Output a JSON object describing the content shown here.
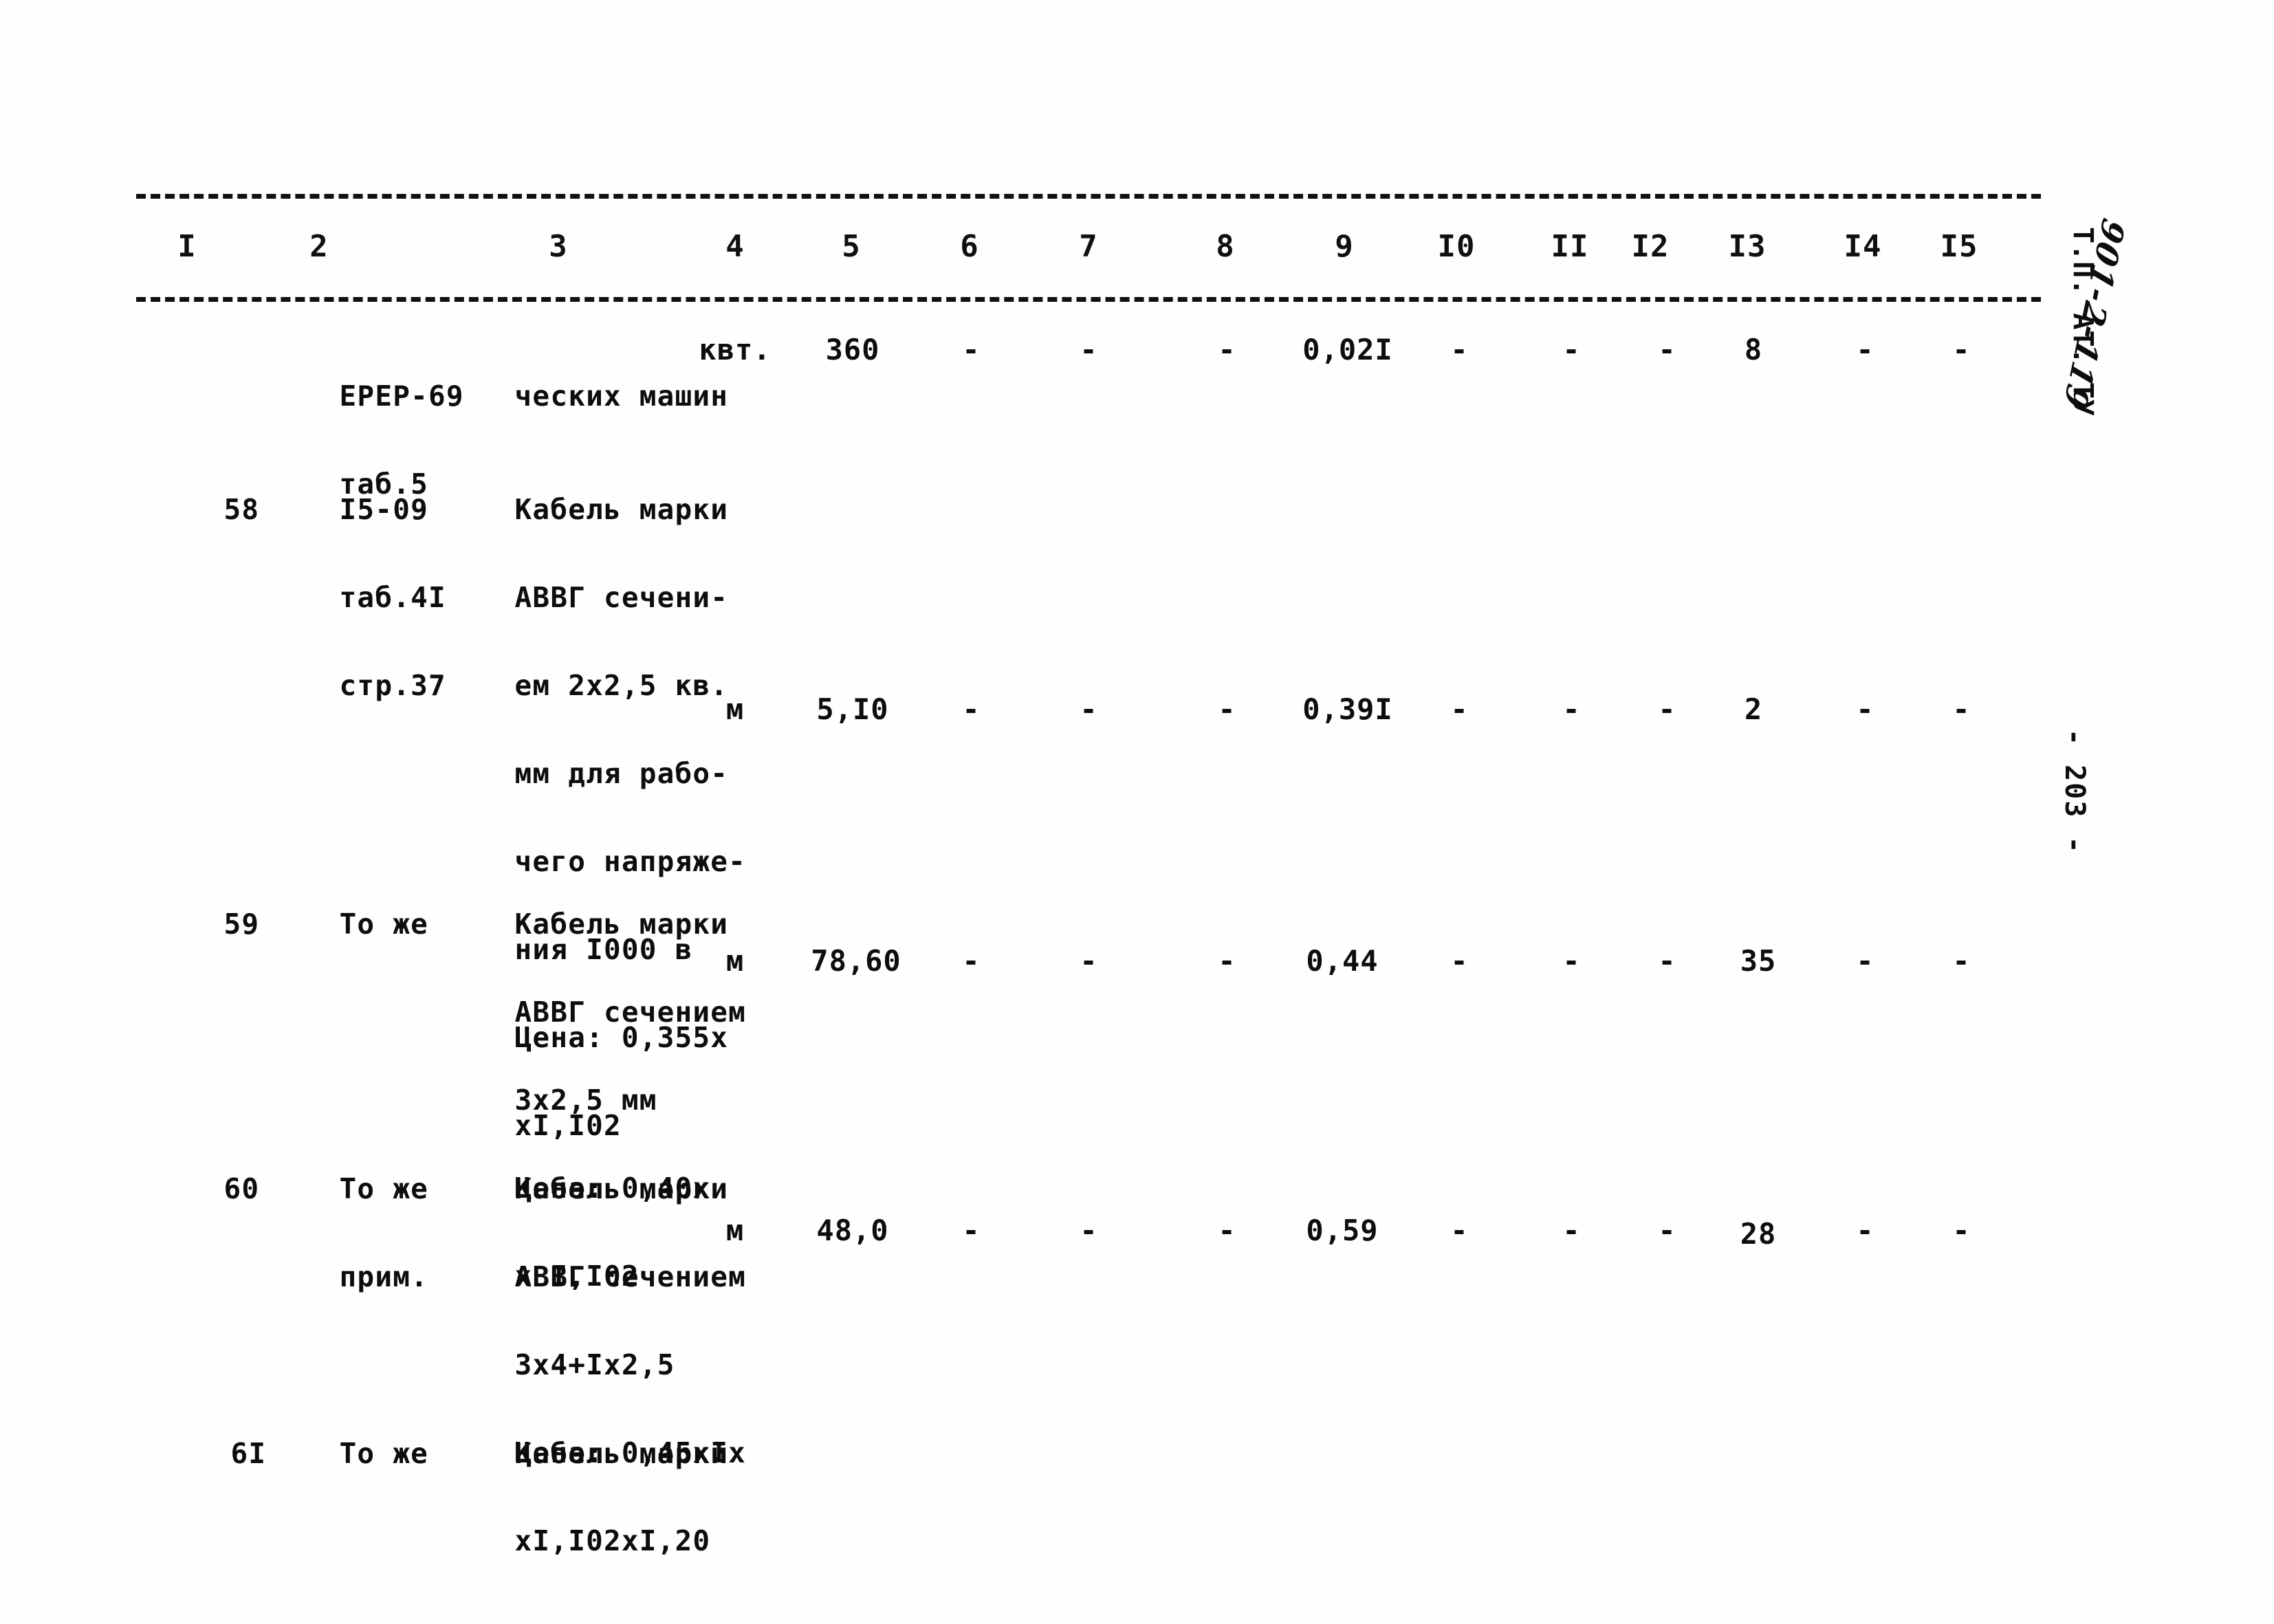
{
  "document": {
    "page_number": "- 203 -",
    "stamp": "Т.П. АТ. ТУ",
    "handwritten_annotation": "901-2-119"
  },
  "table": {
    "column_headers": [
      "I",
      "2",
      "3",
      "4",
      "5",
      "6",
      "7",
      "8",
      "9",
      "I0",
      "II",
      "I2",
      "I3",
      "I4",
      "I5"
    ],
    "rows": [
      {
        "c1": "",
        "c2": [
          "ЕРЕР-69",
          "таб.5"
        ],
        "c3": [
          "ческих машин"
        ],
        "c4": "квт.",
        "c5": "360",
        "c6": "-",
        "c7": "-",
        "c8": "-",
        "c9": "0,02I",
        "c10": "-",
        "c11": "-",
        "c12": "-",
        "c13": "8",
        "c14": "-",
        "c15": "-"
      },
      {
        "c1": "58",
        "c2": [
          "I5-09",
          "таб.4I",
          "стр.37"
        ],
        "c3": [
          "Кабель марки",
          "АВВГ сечени-",
          "ем 2х2,5 кв.",
          "мм для рабо-",
          "чего напряже-",
          "ния I000 в",
          "Цена: 0,355х",
          "хI,I02"
        ],
        "c4": "м",
        "c5": "5,I0",
        "c6": "-",
        "c7": "-",
        "c8": "-",
        "c9": "0,39I",
        "c10": "-",
        "c11": "-",
        "c12": "-",
        "c13": "2",
        "c14": "-",
        "c15": "-"
      },
      {
        "c1": "59",
        "c2": [
          "То же"
        ],
        "c3": [
          "Кабель марки",
          "АВВГ сечением",
          "3х2,5 мм",
          "Цена: 0,40х",
          "х I,I02"
        ],
        "c4": "м",
        "c5": "78,60",
        "c6": "-",
        "c7": "-",
        "c8": "-",
        "c9": "0,44",
        "c10": "-",
        "c11": "-",
        "c12": "-",
        "c13": "35",
        "c14": "-",
        "c15": "-"
      },
      {
        "c1": "60",
        "c2": [
          "То же",
          "прим."
        ],
        "c3": [
          "Кабель марки",
          "АВВГ сечением",
          "3х4+Iх2,5",
          "Цена: 0,45хIх",
          "хI,I02хI,20"
        ],
        "c4": "м",
        "c5": "48,0",
        "c6": "-",
        "c7": "-",
        "c8": "-",
        "c9": "0,59",
        "c10": "-",
        "c11": "-",
        "c12": "-",
        "c13": "28",
        "c14": "-",
        "c15": "-"
      },
      {
        "c1": "6I",
        "c2": [
          "То же"
        ],
        "c3": [
          "Кабель марки"
        ],
        "c4": "",
        "c5": "",
        "c6": "",
        "c7": "",
        "c8": "",
        "c9": "",
        "c10": "",
        "c11": "",
        "c12": "",
        "c13": "",
        "c14": "",
        "c15": ""
      }
    ]
  }
}
